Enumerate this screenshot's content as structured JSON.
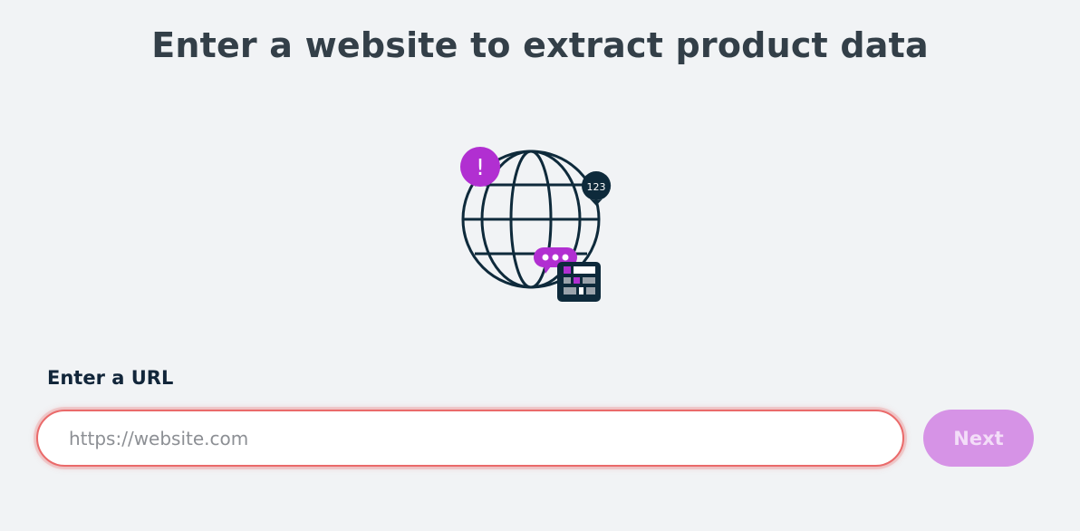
{
  "header": {
    "title": "Enter a website to extract product data"
  },
  "illustration": {
    "badge_number": "123",
    "alert_symbol": "!",
    "icons": [
      "globe-icon",
      "alert-icon",
      "map-pin-icon",
      "chat-bubble-icon",
      "table-grid-icon"
    ],
    "colors": {
      "stroke": "#0e2a3b",
      "accent": "#b12fd1",
      "gray": "#9aa3ab"
    }
  },
  "form": {
    "url_label": "Enter a URL",
    "url_placeholder": "https://website.com",
    "url_value": "",
    "next_label": "Next",
    "next_enabled": false
  },
  "colors": {
    "background": "#f1f3f5",
    "title_text": "#333f48",
    "input_error_border": "#ea6a6a",
    "button_disabled_bg": "#d693e6",
    "button_disabled_text": "#f3ddf8"
  }
}
